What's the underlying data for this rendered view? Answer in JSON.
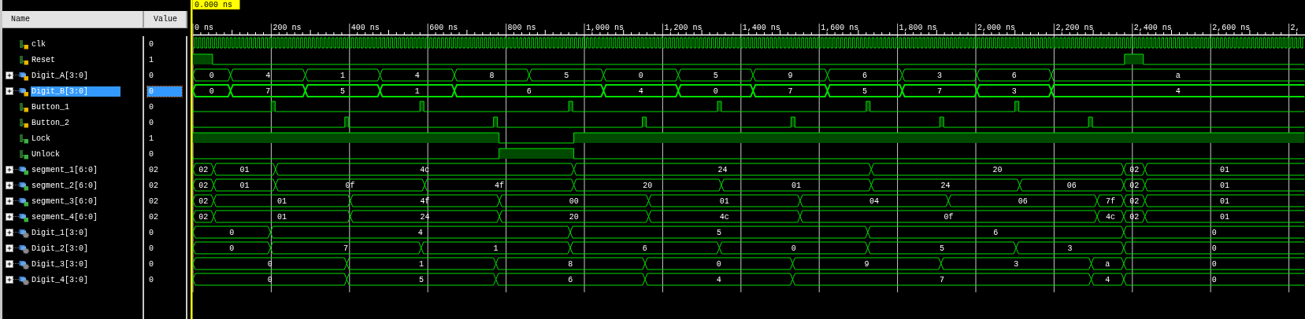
{
  "cursor": {
    "label": "0.000 ns"
  },
  "columns": [
    "Name",
    "Value"
  ],
  "signals": [
    {
      "name": "clk",
      "value": "0",
      "kind": "bit",
      "color": "#e8b400",
      "selected": false
    },
    {
      "name": "Reset",
      "value": "1",
      "kind": "bit",
      "color": "#e8b400",
      "selected": false
    },
    {
      "name": "Digit_A[3:0]",
      "value": "0",
      "kind": "bus",
      "color": "#e8b400",
      "expanded": false,
      "selected": false
    },
    {
      "name": "Digit_B[3:0]",
      "value": "0",
      "kind": "bus",
      "color": "#e8b400",
      "expanded": false,
      "selected": true
    },
    {
      "name": "Button_1",
      "value": "0",
      "kind": "bit",
      "color": "#e8b400",
      "selected": false
    },
    {
      "name": "Button_2",
      "value": "0",
      "kind": "bit",
      "color": "#e8b400",
      "selected": false
    },
    {
      "name": "Lock",
      "value": "1",
      "kind": "bit",
      "color": "#3cb043",
      "selected": false
    },
    {
      "name": "Unlock",
      "value": "0",
      "kind": "bit",
      "color": "#3cb043",
      "selected": false
    },
    {
      "name": "segment_1[6:0]",
      "value": "02",
      "kind": "bus",
      "color": "#3cb043",
      "expanded": false,
      "selected": false
    },
    {
      "name": "segment_2[6:0]",
      "value": "02",
      "kind": "bus",
      "color": "#3cb043",
      "expanded": false,
      "selected": false
    },
    {
      "name": "segment_3[6:0]",
      "value": "02",
      "kind": "bus",
      "color": "#3cb043",
      "expanded": false,
      "selected": false
    },
    {
      "name": "segment_4[6:0]",
      "value": "02",
      "kind": "bus",
      "color": "#3cb043",
      "expanded": false,
      "selected": false
    },
    {
      "name": "Digit_1[3:0]",
      "value": "0",
      "kind": "internal-bus",
      "color": "#8a8a8a",
      "expanded": false,
      "selected": false
    },
    {
      "name": "Digit_2[3:0]",
      "value": "0",
      "kind": "internal-bus",
      "color": "#8a8a8a",
      "expanded": false,
      "selected": false
    },
    {
      "name": "Digit_3[3:0]",
      "value": "0",
      "kind": "internal-bus",
      "color": "#8a8a8a",
      "expanded": false,
      "selected": false
    },
    {
      "name": "Digit_4[3:0]",
      "value": "0",
      "kind": "internal-bus",
      "color": "#8a8a8a",
      "expanded": false,
      "selected": false
    }
  ],
  "waveform": {
    "time_labels": [
      "0 ns",
      "200 ns",
      "400 ns",
      "600 ns",
      "800 ns",
      "1,000 ns",
      "1,200 ns",
      "1,400 ns",
      "1,600 ns",
      "1,800 ns",
      "2,000 ns",
      "2,200 ns",
      "2,400 ns",
      "2,600 ns",
      "2,"
    ],
    "traces": [
      {
        "kind": "clock"
      },
      {
        "kind": "bit",
        "high": [
          true,
          false,
          true,
          false
        ]
      },
      {
        "kind": "bus",
        "labels": [
          "0",
          "4",
          "1",
          "4",
          "8",
          "5",
          "0",
          "5",
          "9",
          "6",
          "3",
          "6",
          "a"
        ]
      },
      {
        "kind": "bus",
        "labels": [
          "0",
          "7",
          "5",
          "1",
          "6",
          "4",
          "0",
          "7",
          "5",
          "7",
          "3",
          "4"
        ]
      },
      {
        "kind": "bit",
        "high": [
          false,
          true,
          false,
          true,
          false,
          true,
          false,
          true,
          false,
          true,
          false,
          true,
          false
        ]
      },
      {
        "kind": "bit",
        "high": [
          false,
          true,
          false,
          true,
          false,
          true,
          false,
          true,
          false,
          true,
          false,
          true,
          false
        ]
      },
      {
        "kind": "bit",
        "high": [
          true,
          false,
          true
        ]
      },
      {
        "kind": "bit",
        "high": [
          false,
          true,
          false
        ]
      },
      {
        "kind": "bus",
        "labels": [
          "02",
          "01",
          "4c",
          "24",
          "20",
          "02",
          "01"
        ]
      },
      {
        "kind": "bus",
        "labels": [
          "02",
          "01",
          "0f",
          "4f",
          "20",
          "01",
          "24",
          "06",
          "02",
          "01"
        ]
      },
      {
        "kind": "bus",
        "labels": [
          "02",
          "01",
          "4f",
          "00",
          "01",
          "04",
          "06",
          "7f",
          "02",
          "01"
        ]
      },
      {
        "kind": "bus",
        "labels": [
          "02",
          "01",
          "24",
          "20",
          "4c",
          "0f",
          "4c",
          "02",
          "01"
        ]
      },
      {
        "kind": "bus",
        "labels": [
          "0",
          "4",
          "5",
          "6",
          "0"
        ]
      },
      {
        "kind": "bus",
        "labels": [
          "0",
          "7",
          "1",
          "6",
          "0",
          "5",
          "3",
          "0"
        ]
      },
      {
        "kind": "bus",
        "labels": [
          "0",
          "1",
          "8",
          "0",
          "9",
          "3",
          "a",
          "0"
        ]
      },
      {
        "kind": "bus",
        "labels": [
          "0",
          "5",
          "6",
          "4",
          "7",
          "4",
          "0"
        ]
      }
    ]
  }
}
